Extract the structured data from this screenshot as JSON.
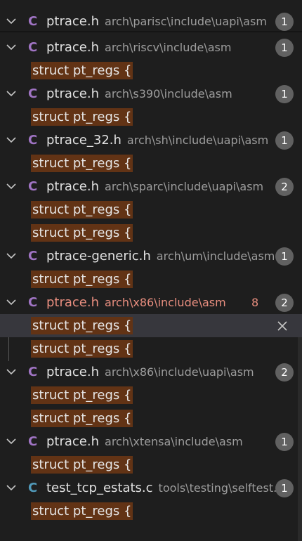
{
  "colors": {
    "background": "#1e1e1e",
    "match_highlight": "#623315",
    "selected_row": "#37373d",
    "badge": "#616161",
    "error_text": "#e88e7f",
    "c_icon_purple": "#a074c4",
    "c_icon_blue": "#519aba"
  },
  "icons": {
    "chevron": "chevron-down-icon",
    "file": "c-language-icon",
    "close": "close-icon"
  },
  "results": [
    {
      "file": "ptrace.h",
      "path": "arch\\parisc\\include\\uapi\\asm",
      "count": "1",
      "icon": "C",
      "icon_color": "purple",
      "matches": []
    },
    {
      "file": "ptrace.h",
      "path": "arch\\riscv\\include\\asm",
      "count": "1",
      "icon": "C",
      "icon_color": "purple",
      "matches": [
        "struct pt_regs {"
      ]
    },
    {
      "file": "ptrace.h",
      "path": "arch\\s390\\include\\asm",
      "count": "1",
      "icon": "C",
      "icon_color": "purple",
      "matches": [
        "struct pt_regs {"
      ]
    },
    {
      "file": "ptrace_32.h",
      "path": "arch\\sh\\include\\uapi\\asm",
      "count": "1",
      "icon": "C",
      "icon_color": "purple",
      "matches": [
        "struct pt_regs {"
      ]
    },
    {
      "file": "ptrace.h",
      "path": "arch\\sparc\\include\\uapi\\asm",
      "count": "2",
      "icon": "C",
      "icon_color": "purple",
      "matches": [
        "struct pt_regs {",
        "struct pt_regs {"
      ]
    },
    {
      "file": "ptrace-generic.h",
      "path": "arch\\um\\include\\asm",
      "count": "1",
      "icon": "C",
      "icon_color": "purple",
      "matches": [
        "struct pt_regs {"
      ]
    },
    {
      "file": "ptrace.h",
      "path": "arch\\x86\\include\\asm",
      "count": "2",
      "icon": "C",
      "icon_color": "purple",
      "problems": "8",
      "error": true,
      "matches": [
        "struct pt_regs {",
        "struct pt_regs {"
      ]
    },
    {
      "file": "ptrace.h",
      "path": "arch\\x86\\include\\uapi\\asm",
      "count": "2",
      "icon": "C",
      "icon_color": "purple",
      "matches": [
        "struct pt_regs {",
        "struct pt_regs {"
      ]
    },
    {
      "file": "ptrace.h",
      "path": "arch\\xtensa\\include\\asm",
      "count": "1",
      "icon": "C",
      "icon_color": "purple",
      "matches": [
        "struct pt_regs {"
      ]
    },
    {
      "file": "test_tcp_estats.c",
      "path": "tools\\testing\\selftest...",
      "count": "1",
      "icon": "C",
      "icon_color": "blue",
      "matches": [
        "struct pt_regs {"
      ]
    }
  ]
}
